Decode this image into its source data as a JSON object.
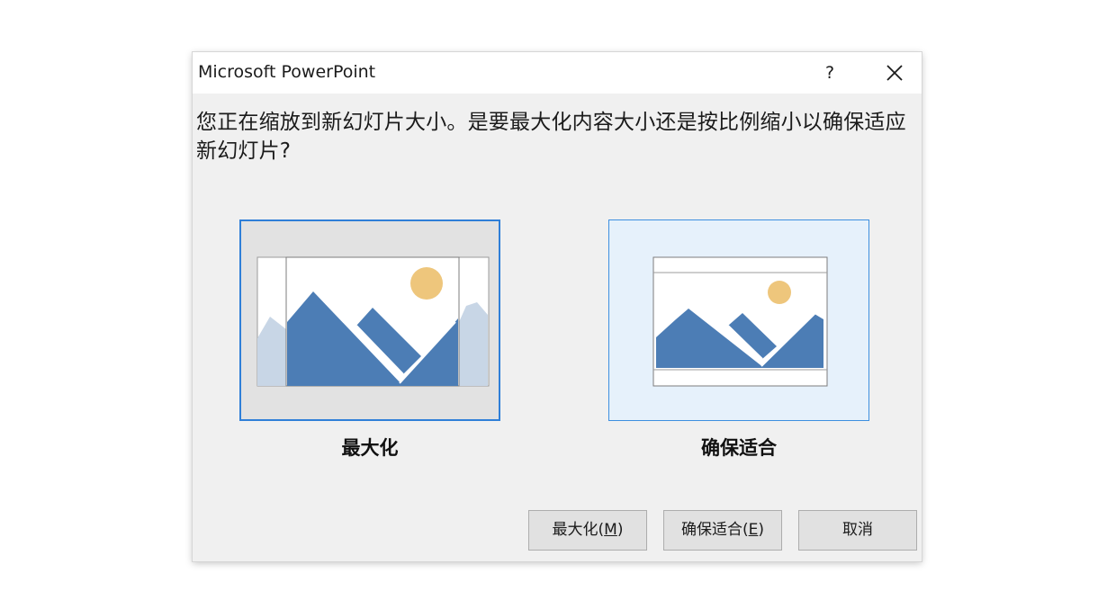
{
  "window": {
    "title": "Microsoft PowerPoint",
    "help_label": "?",
    "close_icon": "close-icon"
  },
  "message": "您正在缩放到新幻灯片大小。是要最大化内容大小还是按比例缩小以确保适应新幻灯片?",
  "options": [
    {
      "label": "最大化",
      "icon": "maximize-preview-icon",
      "selected": true
    },
    {
      "label": "确保适合",
      "icon": "ensure-fit-preview-icon",
      "selected": false
    }
  ],
  "buttons": {
    "maximize": {
      "text": "最大化(",
      "mnemonic": "M",
      "suffix": ")"
    },
    "ensure_fit": {
      "text": "确保适合(",
      "mnemonic": "E",
      "suffix": ")"
    },
    "cancel": {
      "label": "取消"
    }
  },
  "colors": {
    "accent_border": "#2f7fd8",
    "mountain": "#4c7db5",
    "mountain_faded": "#c8d6e6",
    "sun": "#eec67c",
    "dialog_bg": "#f0f0f0",
    "selected_option_bg": "#e2e2e2",
    "hover_option_bg": "#e6f1fb"
  }
}
